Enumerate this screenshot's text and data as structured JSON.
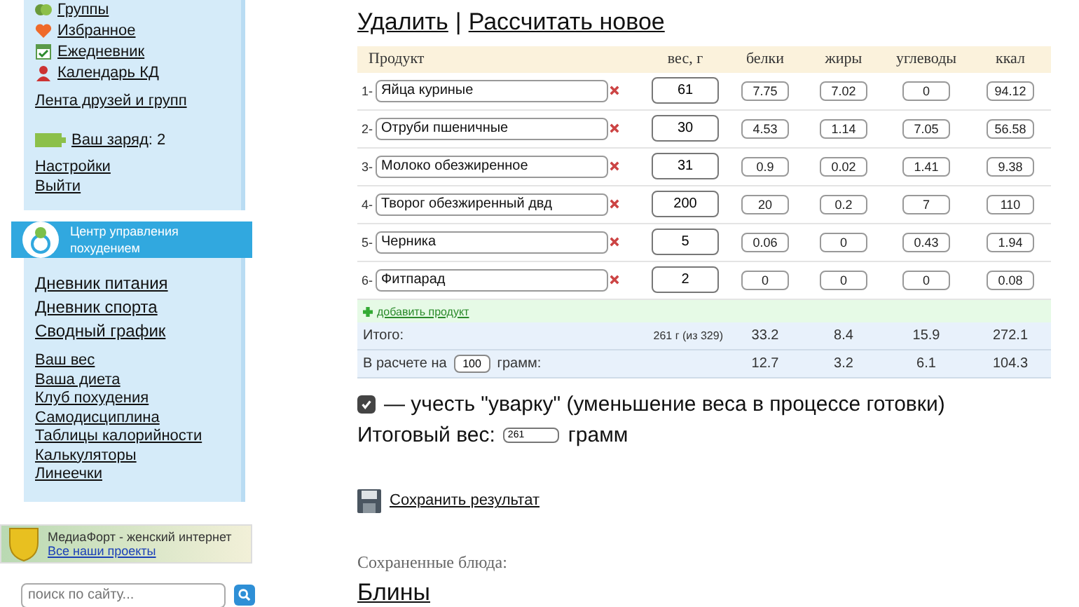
{
  "sidebar": {
    "nav_items": [
      {
        "label": "Группы",
        "kind": "group"
      },
      {
        "label": "Избранное",
        "kind": "heart"
      },
      {
        "label": "Ежедневник",
        "kind": "calendar"
      },
      {
        "label": "Календарь КД",
        "kind": "person"
      }
    ],
    "friends_feed": "Лента друзей и групп",
    "charge": {
      "label": "Ваш заряд",
      "value": ": 2"
    },
    "account_links": [
      "Настройки",
      "Выйти"
    ],
    "center": {
      "title": "Центр управления похудением"
    },
    "diary_links": [
      "Дневник питания",
      "Дневник спорта",
      "Сводный график"
    ],
    "tools_links": [
      "Ваш вес",
      "Ваша диета",
      "Клуб похудения",
      "Самодисциплина",
      "Таблицы калорийности",
      "Калькуляторы",
      "Линеечки"
    ],
    "partner": {
      "text": "МедиаФорт - женский интернет",
      "link": "Все наши проекты"
    },
    "search": {
      "placeholder": "поиск по сайту..."
    }
  },
  "main": {
    "actions": [
      {
        "label": "Удалить"
      },
      {
        "label": "Рассчитать новое"
      }
    ],
    "action_separator": "|",
    "table": {
      "columns": [
        "Продукт",
        "вес, г",
        "белки",
        "жиры",
        "углеводы",
        "ккал"
      ],
      "rows": [
        {
          "number": "1-",
          "product": "Яйца куриные",
          "weight": "61",
          "values": [
            "7.75",
            "7.02",
            "0",
            "94.12"
          ]
        },
        {
          "number": "2-",
          "product": "Отруби пшеничные",
          "weight": "30",
          "values": [
            "4.53",
            "1.14",
            "7.05",
            "56.58"
          ]
        },
        {
          "number": "3-",
          "product": "Молоко обезжиренное",
          "weight": "31",
          "values": [
            "0.9",
            "0.02",
            "1.41",
            "9.38"
          ]
        },
        {
          "number": "4-",
          "product": "Творог обезжиренный двд",
          "weight": "200",
          "values": [
            "20",
            "0.2",
            "7",
            "110"
          ]
        },
        {
          "number": "5-",
          "product": "Черника",
          "weight": "5",
          "values": [
            "0.06",
            "0",
            "0.43",
            "1.94"
          ]
        },
        {
          "number": "6-",
          "product": "Фитпарад",
          "weight": "2",
          "values": [
            "0",
            "0",
            "0",
            "0.08"
          ]
        }
      ],
      "add_link": "добавить продукт",
      "totals": {
        "label": "Итого:",
        "weight": "261 г (из 329)",
        "values": [
          "33.2",
          "8.4",
          "15.9",
          "272.1"
        ]
      },
      "per_amount": {
        "label_before": "В расчете на",
        "amount": "100",
        "label_after": "грамм:",
        "values": [
          "12.7",
          "3.2",
          "6.1",
          "104.3"
        ]
      }
    },
    "boil_off": {
      "checked": true,
      "label": "— учесть \"уварку\" (уменьшение веса в процессе готовки)"
    },
    "final_weight": {
      "label": "Итоговый вес:",
      "value": "261",
      "unit": "грамм"
    },
    "save_link": "Сохранить результат",
    "saved": {
      "heading": "Сохраненные блюда:",
      "dishes": [
        "Блины"
      ]
    }
  }
}
